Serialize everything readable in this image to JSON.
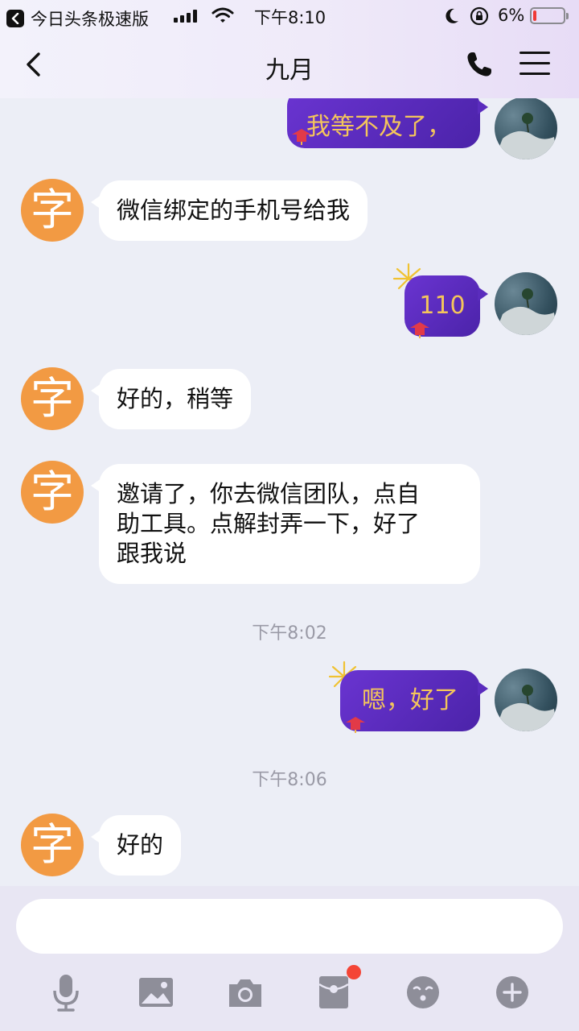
{
  "status_bar": {
    "back_app_label": "今日头条极速版",
    "time": "下午8:10",
    "battery_percent": "6%",
    "battery_level": 0.06,
    "icons": [
      "back-arrow-icon",
      "signal-icon",
      "wifi-icon",
      "moon-icon",
      "rotation-lock-icon",
      "battery-icon"
    ]
  },
  "header": {
    "title": "九月",
    "icons": [
      "back-chevron-icon",
      "phone-icon",
      "menu-icon"
    ]
  },
  "messages": [
    {
      "side": "right",
      "text": "我等不及了，"
    },
    {
      "side": "left",
      "avatar_text": "字",
      "text": "微信绑定的手机号给我"
    },
    {
      "side": "right",
      "text": "110"
    },
    {
      "side": "left",
      "avatar_text": "字",
      "text": "好的，稍等"
    },
    {
      "side": "left",
      "avatar_text": "字",
      "lines": [
        "邀请了，你去微信团队，点自",
        "助工具。点解封弄一下，好了",
        "跟我说"
      ]
    },
    {
      "side": "right",
      "text": "嗯，好了"
    },
    {
      "side": "left",
      "avatar_text": "字",
      "text": "好的"
    }
  ],
  "timestamps": [
    "下午8:02",
    "下午8:06"
  ],
  "input": {
    "value": "",
    "placeholder": ""
  },
  "toolbar": {
    "icons": [
      "microphone-icon",
      "image-icon",
      "camera-icon",
      "red-packet-icon",
      "emoji-icon",
      "plus-icon"
    ],
    "red_packet_badge": true
  },
  "colors": {
    "header_gradient_end": "#e7dcf6",
    "chat_background": "#eceef6",
    "avatar_orange": "#f29a43",
    "bubble_purple": "#5a2cbd",
    "bubble_text_gold": "#f4c55b",
    "badge_red": "#f44536"
  }
}
